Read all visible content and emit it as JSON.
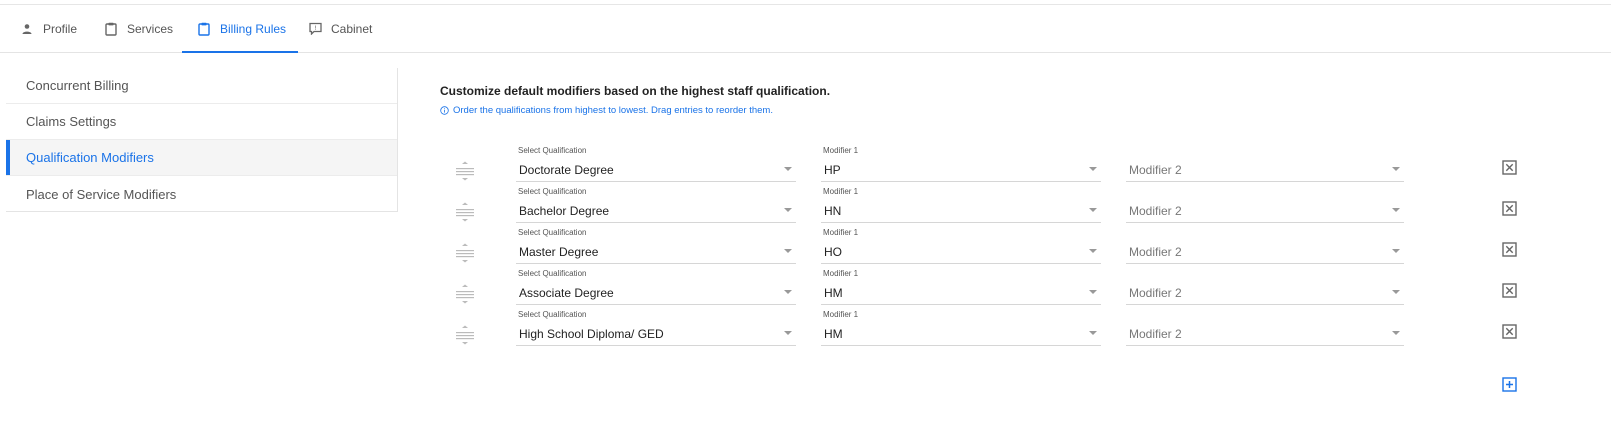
{
  "tabs": [
    {
      "label": "Profile",
      "icon": "person-icon"
    },
    {
      "label": "Services",
      "icon": "clipboard-icon"
    },
    {
      "label": "Billing Rules",
      "icon": "clipboard-icon",
      "active": true
    },
    {
      "label": "Cabinet",
      "icon": "chat-icon"
    }
  ],
  "sidebar": {
    "items": [
      {
        "label": "Concurrent Billing"
      },
      {
        "label": "Claims Settings"
      },
      {
        "label": "Qualification Modifiers",
        "active": true
      },
      {
        "label": "Place of Service Modifiers"
      }
    ]
  },
  "main": {
    "title": "Customize default modifiers based on the highest staff qualification.",
    "hint": "Order the qualifications from highest to lowest. Drag entries to reorder them.",
    "qualification_label": "Select Qualification",
    "modifier1_label": "Modifier 1",
    "modifier2_placeholder": "Modifier 2",
    "rows": [
      {
        "qualification": "Doctorate Degree",
        "modifier1": "HP"
      },
      {
        "qualification": "Bachelor Degree",
        "modifier1": "HN"
      },
      {
        "qualification": "Master Degree",
        "modifier1": "HO"
      },
      {
        "qualification": "Associate Degree",
        "modifier1": "HM"
      },
      {
        "qualification": "High School Diploma/ GED",
        "modifier1": "HM"
      }
    ]
  },
  "colors": {
    "accent": "#1a73e8",
    "text": "#222222",
    "muted": "#777777"
  }
}
